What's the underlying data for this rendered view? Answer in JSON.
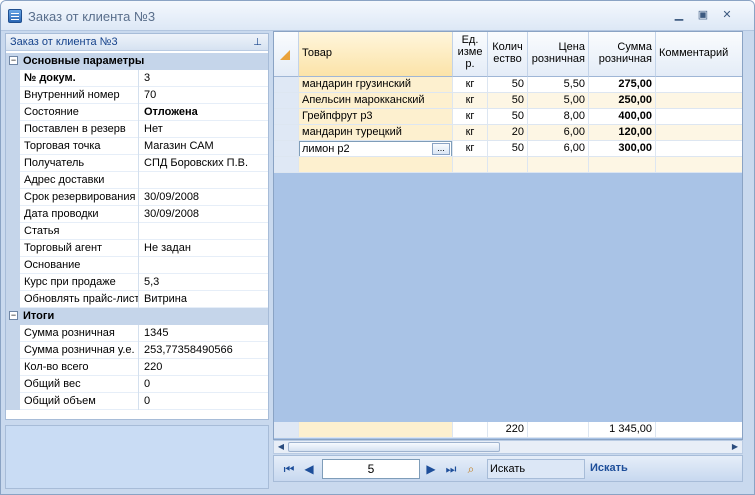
{
  "window": {
    "title": "Заказ от клиента №3"
  },
  "panel": {
    "title": "Заказ от клиента №3",
    "categories": [
      {
        "label": "Основные параметры",
        "toggle": "−",
        "props": [
          {
            "name": "№ докум.",
            "value": "3",
            "bold_name": true
          },
          {
            "name": "Внутренний номер",
            "value": "70"
          },
          {
            "name": "Состояние",
            "value": "Отложена",
            "bold_value": true
          },
          {
            "name": "Поставлен в резерв",
            "value": "Нет"
          },
          {
            "name": "Торговая точка",
            "value": "Магазин САМ"
          },
          {
            "name": "Получатель",
            "value": "СПД Боровских П.В."
          },
          {
            "name": "Адрес доставки",
            "value": ""
          },
          {
            "name": "Срок резервирования",
            "value": "30/09/2008"
          },
          {
            "name": "Дата проводки",
            "value": "30/09/2008"
          },
          {
            "name": "Статья",
            "value": ""
          },
          {
            "name": "Торговый агент",
            "value": "Не задан"
          },
          {
            "name": "Основание",
            "value": ""
          },
          {
            "name": "Курс при продаже",
            "value": "5,3"
          },
          {
            "name": "Обновлять прайс-лист",
            "value": "Витрина"
          }
        ]
      },
      {
        "label": "Итоги",
        "toggle": "−",
        "props": [
          {
            "name": "Сумма розничная",
            "value": "1345"
          },
          {
            "name": "Сумма розничная у.е.",
            "value": "253,77358490566"
          },
          {
            "name": "Кол-во всего",
            "value": "220"
          },
          {
            "name": "Общий вес",
            "value": "0"
          },
          {
            "name": "Общий объем",
            "value": "0"
          }
        ]
      }
    ]
  },
  "grid": {
    "headers": {
      "product": "Товар",
      "unit": [
        "Ед.",
        "изме",
        "р."
      ],
      "qty": [
        "Колич",
        "ество"
      ],
      "price": [
        "Цена",
        "розничная"
      ],
      "sum": [
        "Сумма",
        "розничная"
      ],
      "comment": "Комментарий"
    },
    "rows": [
      {
        "product": "мандарин грузинский",
        "unit": "кг",
        "qty": "50",
        "price": "5,50",
        "sum": "275,00",
        "comment": ""
      },
      {
        "product": "Апельсин марокканский",
        "unit": "кг",
        "qty": "50",
        "price": "5,00",
        "sum": "250,00",
        "comment": ""
      },
      {
        "product": "Грейпфрут р3",
        "unit": "кг",
        "qty": "50",
        "price": "8,00",
        "sum": "400,00",
        "comment": ""
      },
      {
        "product": "мандарин турецкий",
        "unit": "кг",
        "qty": "20",
        "price": "6,00",
        "sum": "120,00",
        "comment": ""
      },
      {
        "product": "лимон р2",
        "unit": "кг",
        "qty": "50",
        "price": "6,00",
        "sum": "300,00",
        "comment": ""
      }
    ],
    "editor_button": "...",
    "footer": {
      "qty_total": "220",
      "sum_total": "1 345,00"
    }
  },
  "navigator": {
    "page": "5",
    "search_value": "Искать",
    "search_button": "Искать"
  },
  "colors": {
    "selected_column": "#fdf0cf",
    "grid_background": "#a9c3e6",
    "header_text": "#15428b"
  }
}
